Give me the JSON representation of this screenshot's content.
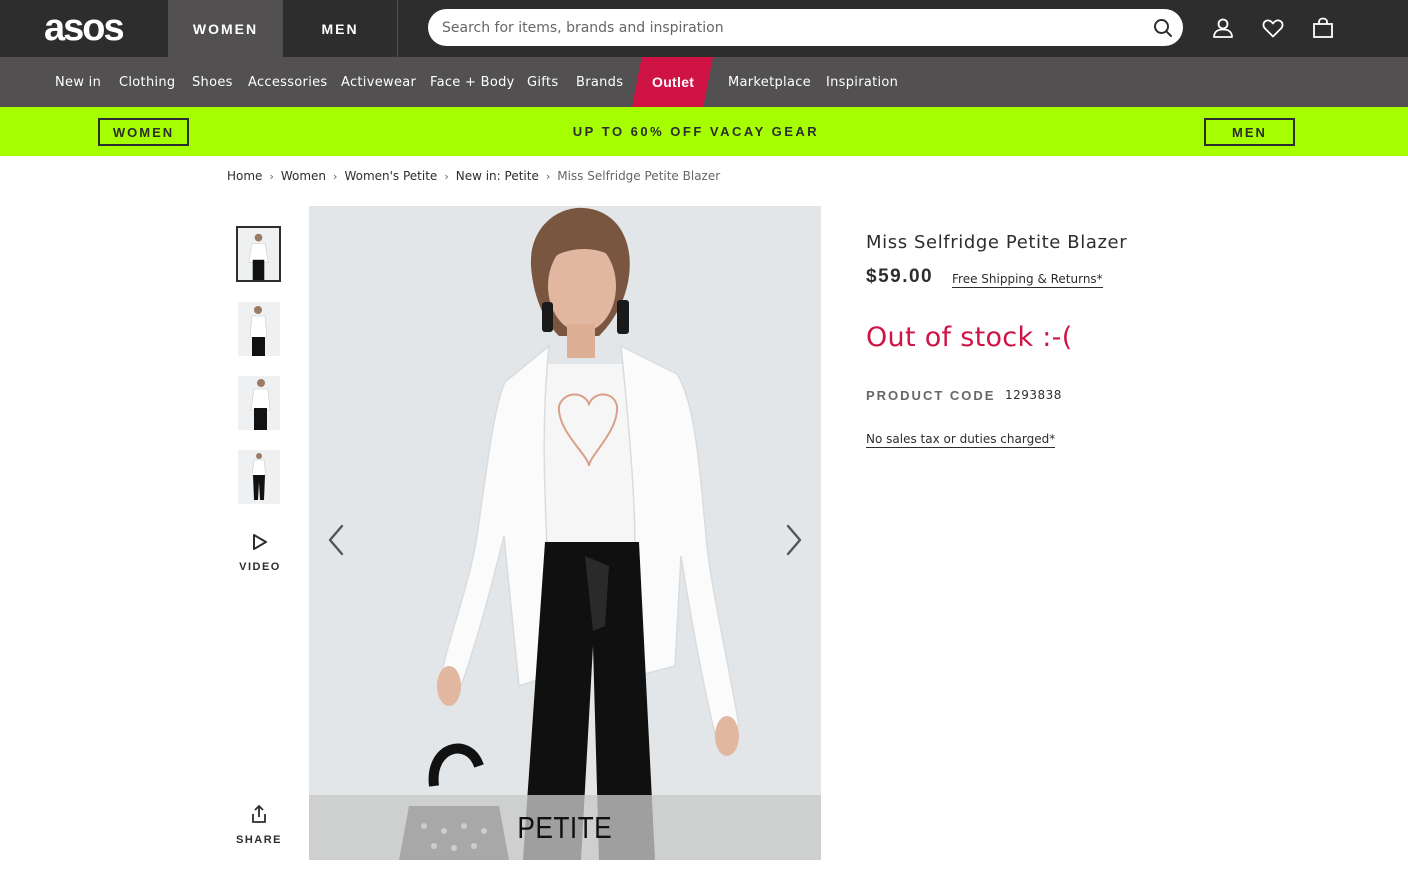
{
  "header": {
    "logo": "asos",
    "gender_tabs": [
      "WOMEN",
      "MEN"
    ],
    "search_placeholder": "Search for items, brands and inspiration",
    "icons": [
      "search-icon",
      "account-icon",
      "heart-icon",
      "bag-icon"
    ]
  },
  "nav": {
    "items": [
      "New in",
      "Clothing",
      "Shoes",
      "Accessories",
      "Activewear",
      "Face + Body",
      "Gifts",
      "Brands",
      "Outlet",
      "Marketplace",
      "Inspiration"
    ],
    "highlight_color": "#d01345"
  },
  "promo": {
    "left_button": "WOMEN",
    "text": "UP TO 60% OFF VACAY GEAR",
    "right_button": "MEN",
    "background": "#a6ff00"
  },
  "breadcrumb": [
    "Home",
    "Women",
    "Women's Petite",
    "New in: Petite",
    "Miss Selfridge Petite Blazer"
  ],
  "gallery": {
    "video_label": "VIDEO",
    "share_label": "SHARE",
    "badge": "PETITE",
    "icons": [
      "play-icon",
      "share-icon",
      "chevron-left-icon",
      "chevron-right-icon"
    ]
  },
  "product": {
    "title": "Miss Selfridge Petite Blazer",
    "price": "$59.00",
    "shipping_link": "Free Shipping & Returns*",
    "stock_status": "Out of stock :-(",
    "stock_color": "#d01345",
    "code_label": "PRODUCT CODE",
    "code_value": "1293838",
    "tax_link": "No sales tax or duties charged*"
  }
}
